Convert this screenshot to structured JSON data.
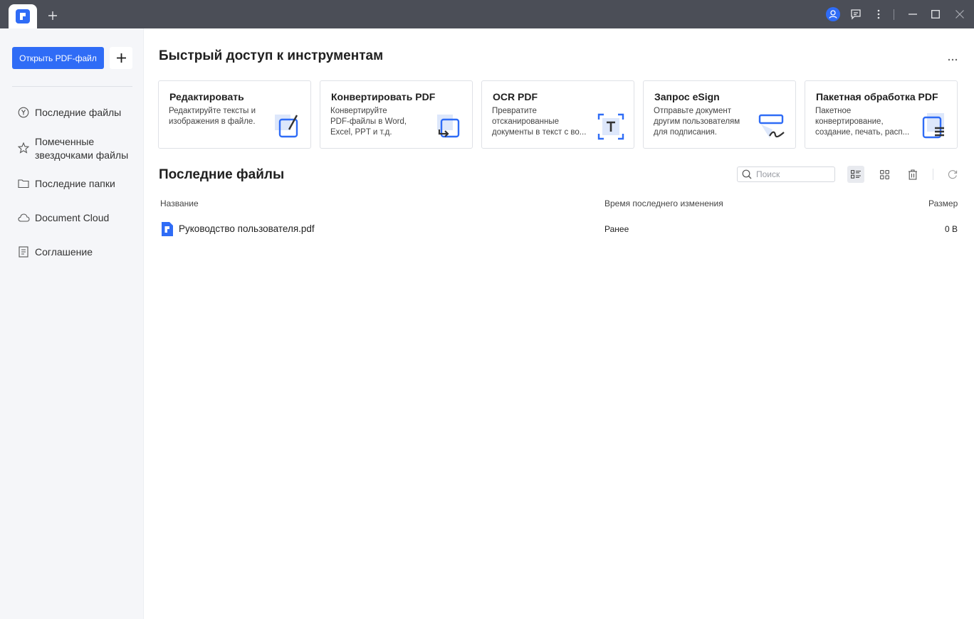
{
  "colors": {
    "accent": "#2f6cf6",
    "titlebar": "#4b4e57",
    "sidebar_bg": "#f5f6f9"
  },
  "sidebar": {
    "open_button": "Открыть PDF-файл",
    "items": [
      {
        "label": "Последние файлы",
        "icon": "clock-icon"
      },
      {
        "label": "Помеченные\nзвездочками файлы",
        "icon": "star-icon"
      },
      {
        "label": "Последние папки",
        "icon": "folder-icon"
      },
      {
        "label": "Document Cloud",
        "icon": "cloud-icon"
      },
      {
        "label": "Соглашение",
        "icon": "document-icon"
      }
    ]
  },
  "quick_access": {
    "title": "Быстрый доступ к инструментам",
    "cards": [
      {
        "title": "Редактировать",
        "desc": "Редактируйте тексты и\nизображения в файле.",
        "icon": "edit-icon"
      },
      {
        "title": "Конвертировать PDF",
        "desc": "Конвертируйте\nPDF-файлы в Word,\nExcel, PPT и т.д.",
        "icon": "convert-icon"
      },
      {
        "title": "OCR PDF",
        "desc": "Превратите\nотсканированные\nдокументы в текст с во...",
        "icon": "ocr-icon"
      },
      {
        "title": "Запрос eSign",
        "desc": "Отправьте документ\nдругим пользователям\nдля подписания.",
        "icon": "esign-icon"
      },
      {
        "title": "Пакетная обработка PDF",
        "desc": "Пакетное\nконвертирование,\nсоздание, печать, расп...",
        "icon": "batch-icon"
      }
    ]
  },
  "recent": {
    "title": "Последние файлы",
    "search_placeholder": "Поиск",
    "columns": {
      "name": "Название",
      "modified": "Время последнего изменения",
      "size": "Размер"
    },
    "rows": [
      {
        "name": "Руководство пользователя.pdf",
        "modified": "Ранее",
        "size": "0 B"
      }
    ]
  }
}
